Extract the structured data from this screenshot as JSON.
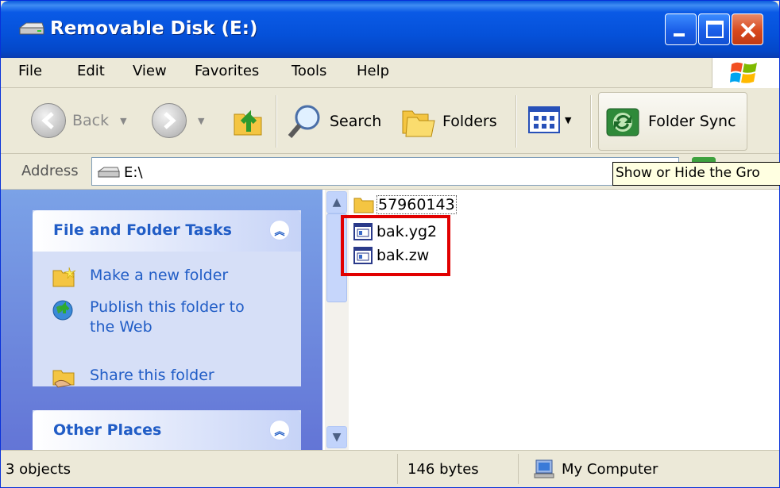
{
  "window": {
    "title": "Removable Disk (E:)",
    "title_icon": "drive-icon",
    "accent": "#0a54e0"
  },
  "menu": {
    "items": [
      "File",
      "Edit",
      "View",
      "Favorites",
      "Tools",
      "Help"
    ]
  },
  "toolbar": {
    "back_label": "Back",
    "search_label": "Search",
    "folders_label": "Folders",
    "sync_label": "Folder Sync"
  },
  "address": {
    "label": "Address",
    "value": "E:\\"
  },
  "tooltip": {
    "text": "Show or Hide the Gro"
  },
  "taskpane": {
    "file_tasks": {
      "title": "File and Folder Tasks",
      "links": [
        {
          "label_line1": "Make a new folder",
          "label_line2": "",
          "icon": "new-folder-icon"
        },
        {
          "label_line1": "Publish this folder to",
          "label_line2": "the Web",
          "icon": "publish-web-icon"
        },
        {
          "label_line1": "Share this folder",
          "label_line2": "",
          "icon": "share-folder-icon"
        }
      ]
    },
    "other_places": {
      "title": "Other Places"
    }
  },
  "files": [
    {
      "name": "57960143",
      "type": "folder"
    },
    {
      "name": "bak.yg2",
      "type": "file"
    },
    {
      "name": "bak.zw",
      "type": "file"
    }
  ],
  "status": {
    "objects": "3 objects",
    "size": "146 bytes",
    "location": "My Computer"
  }
}
